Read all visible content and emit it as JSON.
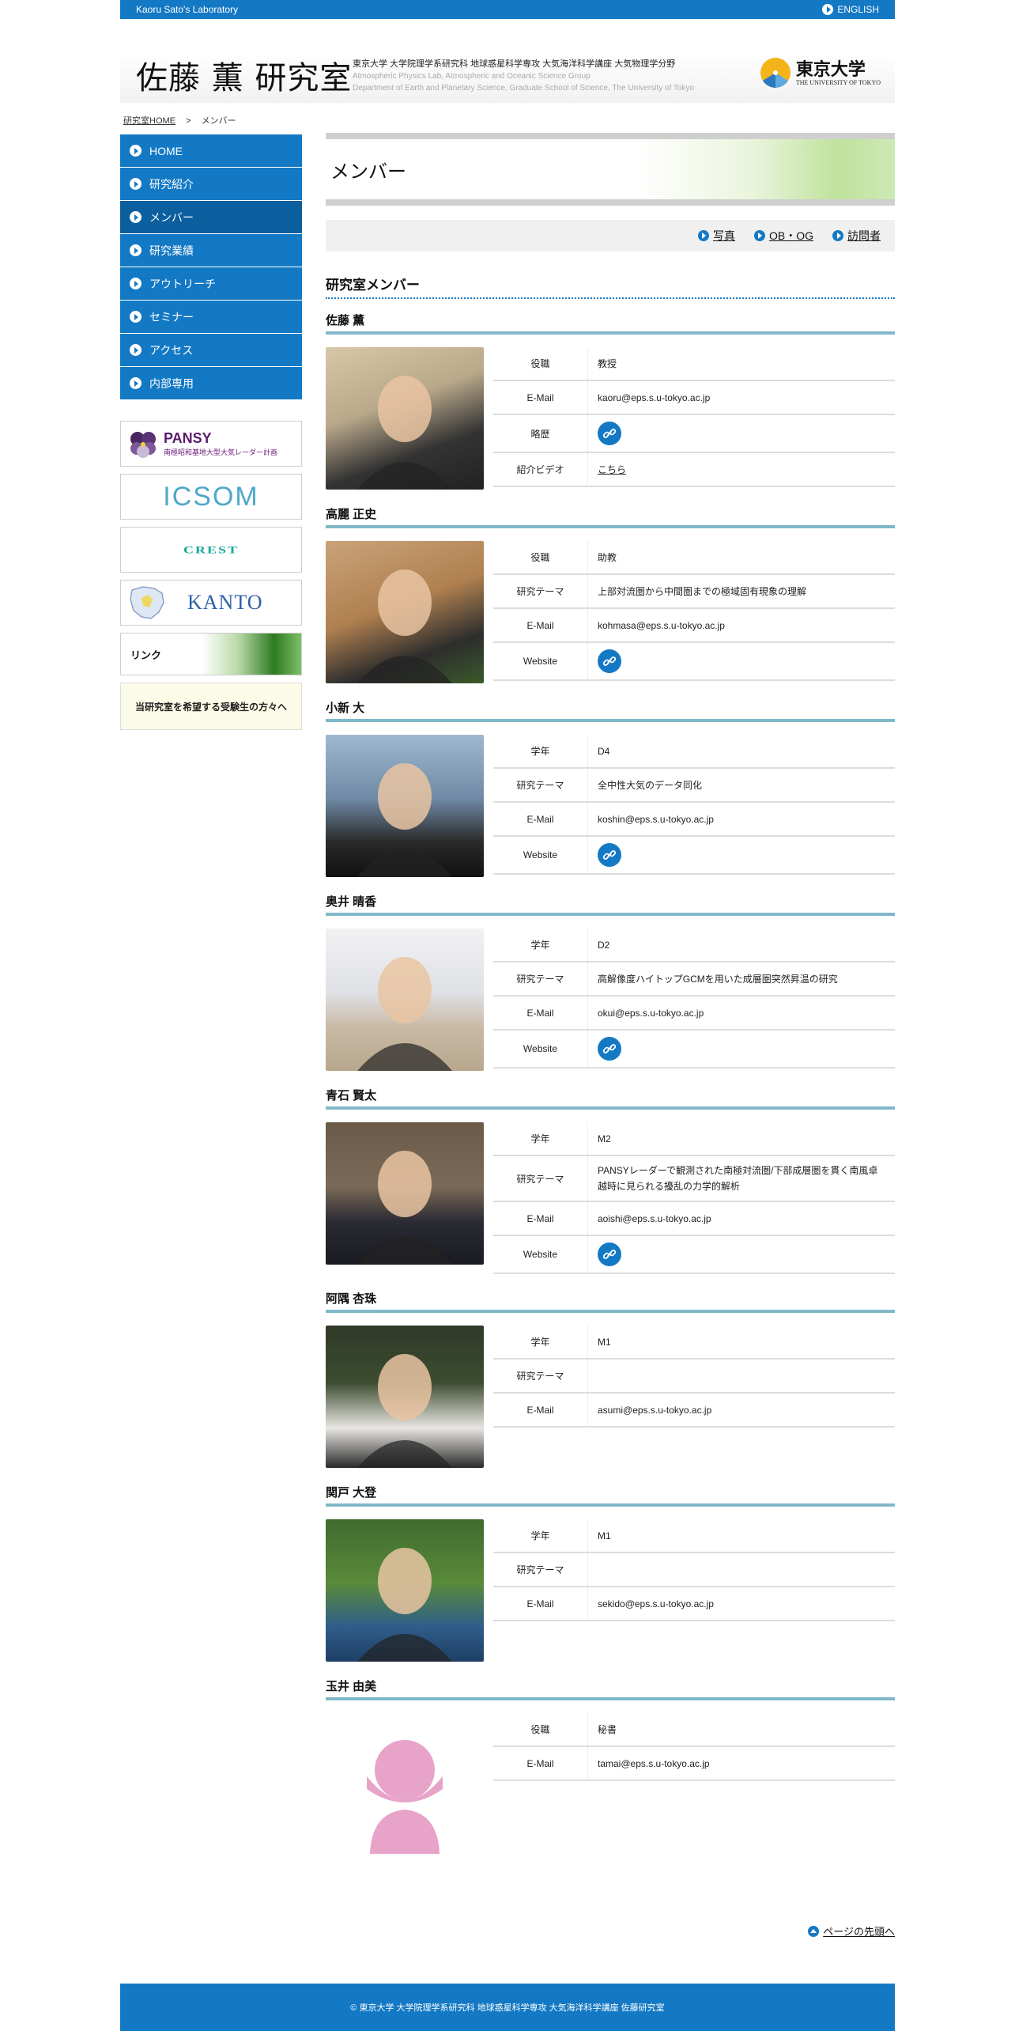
{
  "topbar": {
    "lab_name": "Kaoru Sato's Laboratory",
    "english_link": "ENGLISH"
  },
  "header": {
    "title": "佐藤 薫 研究室",
    "desc_jp": "東京大学 大学院理学系研究科 地球惑星科学専攻 大気海洋科学講座 大気物理学分野",
    "desc_en1": "Atmospheric Physics Lab, Atmospheric and Oceanic Science Group",
    "desc_en2": "Department of Earth and Planetary Science, Graduate School of Science, The University of Tokyo",
    "logo_jp": "東京大学",
    "logo_en": "THE UNIVERSITY OF TOKYO"
  },
  "breadcrumb": {
    "home": "研究室HOME",
    "sep": ">",
    "current": "メンバー"
  },
  "nav": [
    "HOME",
    "研究紹介",
    "メンバー",
    "研究業績",
    "アウトリーチ",
    "セミナー",
    "アクセス",
    "内部専用"
  ],
  "nav_active_index": 2,
  "banners": {
    "pansy_title": "PANSY",
    "pansy_sub": "南極昭和基地大型大気レーダー計画",
    "icsom": "ICSOM",
    "crest": "CREST",
    "kanto": "KANTO",
    "links": "リンク",
    "apply": "当研究室を希望する受験生の方々へ"
  },
  "page_title": "メンバー",
  "sublinks": [
    "写真",
    "OB・OG",
    "訪問者"
  ],
  "section_title": "研究室メンバー",
  "members": [
    {
      "name": "佐藤 薫",
      "rows": [
        {
          "k": "役職",
          "v": "教授"
        },
        {
          "k": "E-Mail",
          "v": "kaoru@eps.s.u-tokyo.ac.jp"
        },
        {
          "k": "略歴",
          "icon": "link-icon"
        },
        {
          "k": "紹介ビデオ",
          "link": "こちら"
        }
      ]
    },
    {
      "name": "高麗 正史",
      "rows": [
        {
          "k": "役職",
          "v": "助教"
        },
        {
          "k": "研究テーマ",
          "v": "上部対流圏から中間圏までの極域固有現象の理解"
        },
        {
          "k": "E-Mail",
          "v": "kohmasa@eps.s.u-tokyo.ac.jp"
        },
        {
          "k": "Website",
          "icon": "link-icon"
        }
      ]
    },
    {
      "name": "小新 大",
      "rows": [
        {
          "k": "学年",
          "v": "D4"
        },
        {
          "k": "研究テーマ",
          "v": "全中性大気のデータ同化"
        },
        {
          "k": "E-Mail",
          "v": "koshin@eps.s.u-tokyo.ac.jp"
        },
        {
          "k": "Website",
          "icon": "link-icon"
        }
      ]
    },
    {
      "name": "奥井 晴香",
      "rows": [
        {
          "k": "学年",
          "v": "D2"
        },
        {
          "k": "研究テーマ",
          "v": "高解像度ハイトップGCMを用いた成層圏突然昇温の研究"
        },
        {
          "k": "E-Mail",
          "v": "okui@eps.s.u-tokyo.ac.jp"
        },
        {
          "k": "Website",
          "icon": "link-icon"
        }
      ]
    },
    {
      "name": "青石 賢太",
      "rows": [
        {
          "k": "学年",
          "v": "M2"
        },
        {
          "k": "研究テーマ",
          "v": "PANSYレーダーで観測された南極対流圏/下部成層圏を貫く南風卓越時に見られる擾乱の力学的解析"
        },
        {
          "k": "E-Mail",
          "v": "aoishi@eps.s.u-tokyo.ac.jp"
        },
        {
          "k": "Website",
          "icon": "link-icon"
        }
      ]
    },
    {
      "name": "阿隅 杏珠",
      "rows": [
        {
          "k": "学年",
          "v": "M1"
        },
        {
          "k": "研究テーマ",
          "v": ""
        },
        {
          "k": "E-Mail",
          "v": "asumi@eps.s.u-tokyo.ac.jp"
        }
      ]
    },
    {
      "name": "関戸 大登",
      "rows": [
        {
          "k": "学年",
          "v": "M1"
        },
        {
          "k": "研究テーマ",
          "v": ""
        },
        {
          "k": "E-Mail",
          "v": "sekido@eps.s.u-tokyo.ac.jp"
        }
      ]
    },
    {
      "name": "玉井 由美",
      "rows": [
        {
          "k": "役職",
          "v": "秘書"
        },
        {
          "k": "E-Mail",
          "v": "tamai@eps.s.u-tokyo.ac.jp"
        }
      ]
    }
  ],
  "pagetop": "ページの先頭へ",
  "footer": "© 東京大学 大学院理学系研究科 地球惑星科学専攻 大気海洋科学講座 佐藤研究室",
  "colors": {
    "brand_blue": "#1479c4",
    "member_rule": "#7fb8c8",
    "placeholder_pink": "#e8a3c9"
  }
}
